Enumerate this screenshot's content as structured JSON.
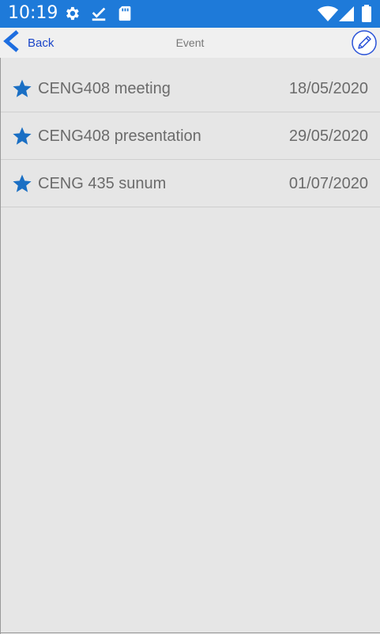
{
  "status_bar": {
    "time": "10:19",
    "icons": [
      "settings-icon",
      "checkmark-download-icon",
      "sd-card-icon",
      "wifi-icon",
      "signal-icon",
      "battery-icon"
    ],
    "background": "#1e7ad9"
  },
  "nav": {
    "back_label": "Back",
    "title": "Event",
    "back_icon": "chevron-left-icon",
    "edit_icon": "pencil-icon",
    "accent": "#1a45c8"
  },
  "events": [
    {
      "name": "CENG408 meeting",
      "date": "18/05/2020",
      "icon": "star-icon"
    },
    {
      "name": "CENG408 presentation",
      "date": "29/05/2020",
      "icon": "star-icon"
    },
    {
      "name": "CENG 435 sunum",
      "date": "01/07/2020",
      "icon": "star-icon"
    }
  ],
  "colors": {
    "star": "#1a6fc4",
    "list_text": "#6b6b6b",
    "page_background": "#e6e6e6"
  }
}
